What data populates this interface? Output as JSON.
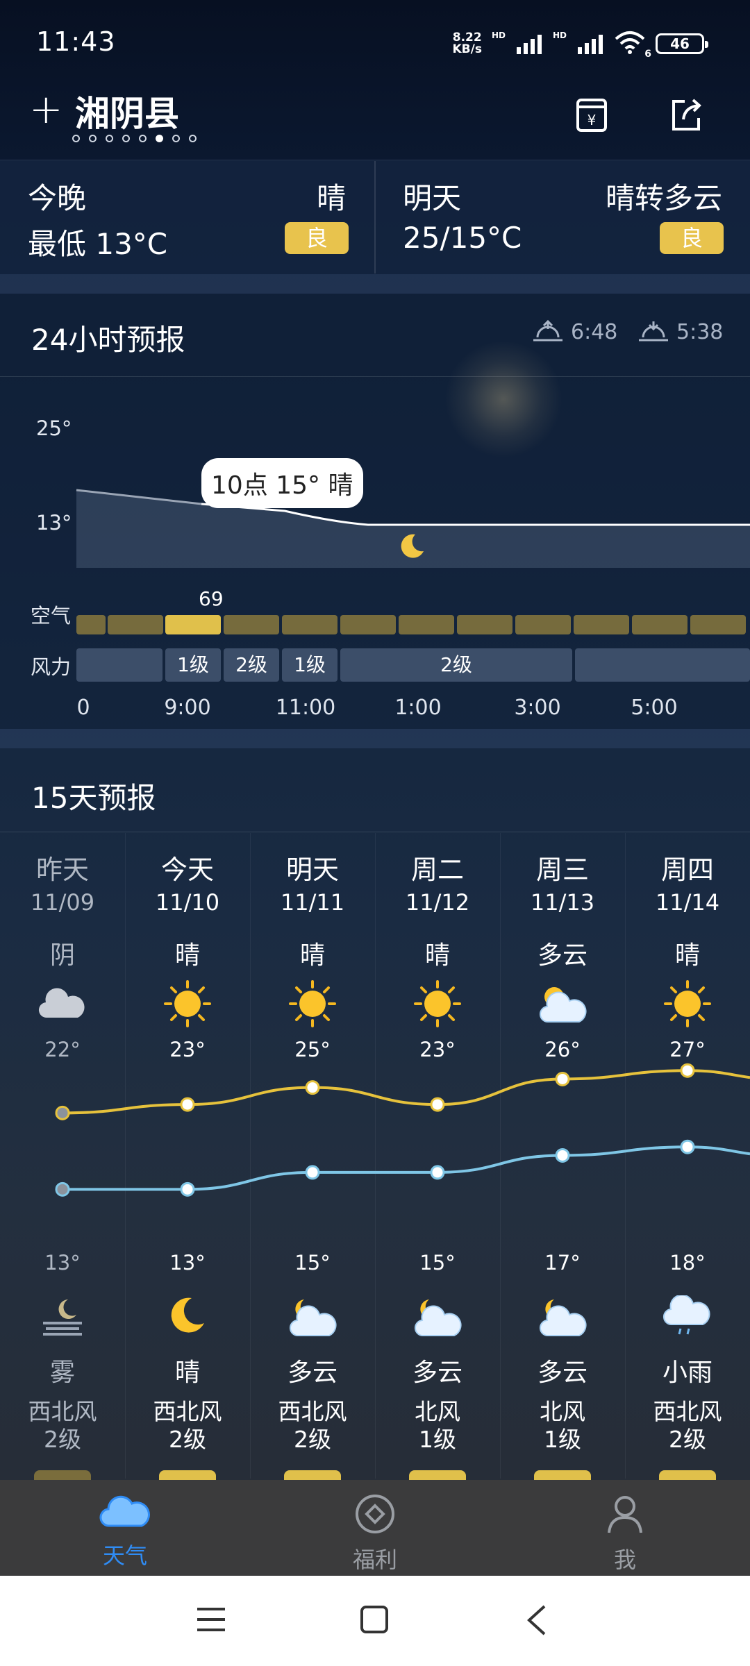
{
  "status": {
    "time": "11:43",
    "net_speed_top": "8.22",
    "net_speed_bottom": "KB/s",
    "hd1": "HD",
    "hd2": "HD",
    "wifi_sub": "6",
    "battery": "46"
  },
  "header": {
    "city": "湘阴县",
    "page_dots": 8,
    "active_dot": 6
  },
  "tonight": {
    "label": "今晚",
    "weather": "晴",
    "temp": "最低 13°C",
    "aqi": "良"
  },
  "tomorrow": {
    "label": "明天",
    "weather": "晴转多云",
    "temp": "25/15°C",
    "aqi": "良"
  },
  "hourly": {
    "title": "24小时预报",
    "sunrise": "6:48",
    "sunset": "5:38",
    "axis_top": "25°",
    "axis_bottom": "13°",
    "tooltip": "10点 15° 晴",
    "air_label": "空气",
    "air_value": "69",
    "wind_label": "风力",
    "wind": [
      "1级",
      "2级",
      "1级",
      "2级"
    ],
    "times": [
      "0",
      "9:00",
      "11:00",
      "1:00",
      "3:00",
      "5:00"
    ]
  },
  "daily": {
    "title": "15天预报",
    "days": [
      {
        "name": "昨天",
        "date": "11/09",
        "day_wx": "阴",
        "hi": "22°",
        "lo": "13°",
        "night_wx": "雾",
        "wind_dir": "西北风",
        "wind_lvl": "2级",
        "past": true
      },
      {
        "name": "今天",
        "date": "11/10",
        "day_wx": "晴",
        "hi": "23°",
        "lo": "13°",
        "night_wx": "晴",
        "wind_dir": "西北风",
        "wind_lvl": "2级"
      },
      {
        "name": "明天",
        "date": "11/11",
        "day_wx": "晴",
        "hi": "25°",
        "lo": "15°",
        "night_wx": "多云",
        "wind_dir": "西北风",
        "wind_lvl": "2级"
      },
      {
        "name": "周二",
        "date": "11/12",
        "day_wx": "晴",
        "hi": "23°",
        "lo": "15°",
        "night_wx": "多云",
        "wind_dir": "北风",
        "wind_lvl": "1级"
      },
      {
        "name": "周三",
        "date": "11/13",
        "day_wx": "多云",
        "hi": "26°",
        "lo": "17°",
        "night_wx": "多云",
        "wind_dir": "北风",
        "wind_lvl": "1级"
      },
      {
        "name": "周四",
        "date": "11/14",
        "day_wx": "晴",
        "hi": "27°",
        "lo": "18°",
        "night_wx": "小雨",
        "wind_dir": "西北风",
        "wind_lvl": "2级"
      }
    ]
  },
  "nav": {
    "weather": "天气",
    "welfare": "福利",
    "me": "我"
  },
  "colors": {
    "accent": "#2f8cf5",
    "aqi_good": "#e8c34d",
    "hi_line": "#e6c23c",
    "lo_line": "#7fc6e6"
  }
}
